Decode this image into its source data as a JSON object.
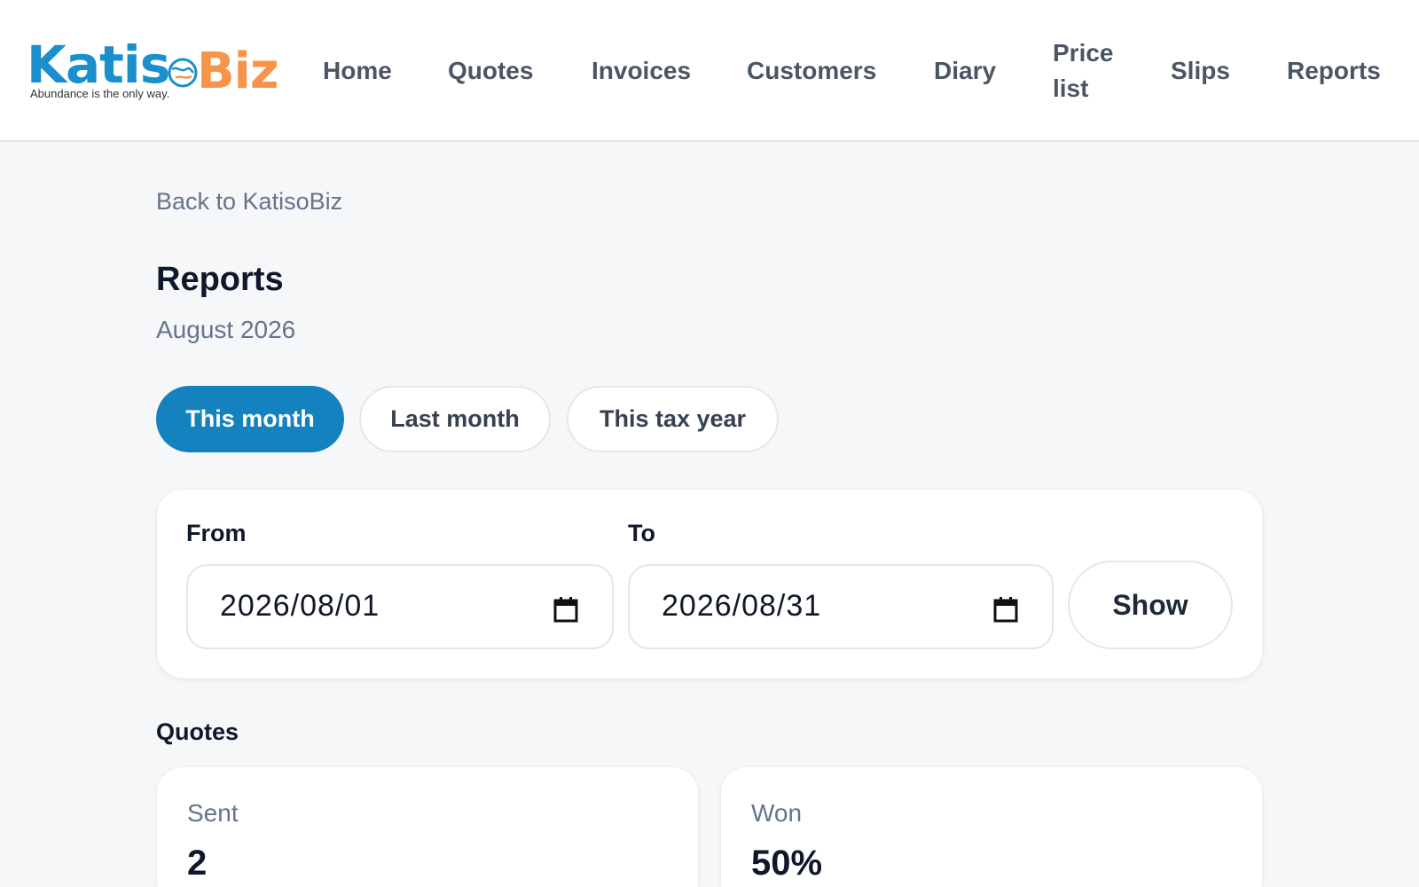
{
  "brand": {
    "name_part1": "Katis",
    "name_part2": "Biz",
    "tagline": "Abundance is the only way.",
    "primary_color": "#1a8fcb",
    "accent_color": "#f7944a"
  },
  "nav": {
    "home": "Home",
    "quotes": "Quotes",
    "invoices": "Invoices",
    "customers": "Customers",
    "diary": "Diary",
    "price_list_line1": "Price",
    "price_list_line2": "list",
    "slips": "Slips",
    "reports": "Reports"
  },
  "back_link": "Back to KatisoBiz",
  "page": {
    "title": "Reports",
    "period": "August 2026"
  },
  "period_buttons": {
    "this_month": "This month",
    "last_month": "Last month",
    "this_tax_year": "This tax year",
    "active": "This month"
  },
  "range": {
    "from_label": "From",
    "from_value": "2026/08/01",
    "to_label": "To",
    "to_value": "2026/08/31",
    "show_label": "Show",
    "icon": "calendar-icon"
  },
  "quotes": {
    "section_title": "Quotes",
    "sent_label": "Sent",
    "sent_value": "2",
    "won_label": "Won",
    "won_value": "50%"
  }
}
